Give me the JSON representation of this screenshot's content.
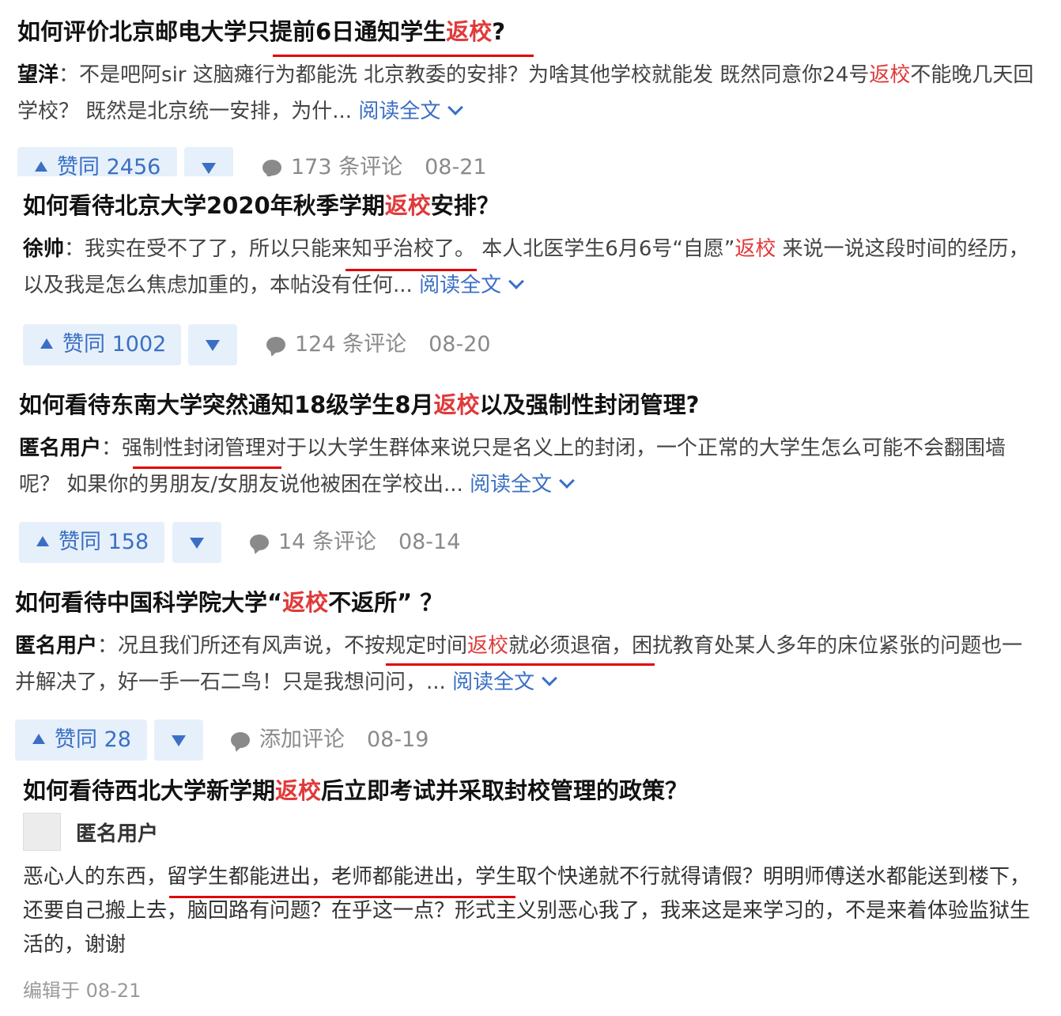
{
  "answers": [
    {
      "title_pre": "如何评价北京邮电大学只提前6日通知学生",
      "title_hl": "返校",
      "title_post": "?",
      "author": "望洋",
      "sep": "：",
      "text_a": "不是吧阿sir 这脑瘫行为都能洗 北京教委的安排？为啥其他学校就能发 既然同意你24号",
      "text_hl": "返校",
      "text_b": "不能晚几天回学校？ 既然是北京统一安排，为什...",
      "read_more": "阅读全文",
      "votes": "赞同 2456",
      "comments": "173 条评论",
      "date": "08-21"
    },
    {
      "title_pre": "如何看待北京大学2020年秋季学期",
      "title_hl": "返校",
      "title_post": "安排？",
      "author": "徐帅",
      "sep": "：",
      "text_a": "我实在受不了了，所以只能来知乎治校了。 本人北医学生6月6号“自愿”",
      "text_hl": "返校",
      "text_b": " 来说一说这段时间的经历，以及我是怎么焦虑加重的，本帖没有任何...",
      "read_more": "阅读全文",
      "votes": "赞同 1002",
      "comments": "124 条评论",
      "date": "08-20"
    },
    {
      "title_pre": "如何看待东南大学突然通知18级学生8月",
      "title_hl": "返校",
      "title_post": "以及强制性封闭管理?",
      "author": "匿名用户",
      "sep": "：",
      "text_a": "强制性封闭管理对于以大学生群体来说只是名义上的封闭，一个正常的大学生怎么可能不会翻围墙呢？ 如果你的男朋友/女朋友说他被困在学校出...",
      "text_hl": "",
      "text_b": "",
      "read_more": "阅读全文",
      "votes": "赞同 158",
      "comments": "14 条评论",
      "date": "08-14"
    },
    {
      "title_pre": "如何看待中国科学院大学“",
      "title_hl": "返校",
      "title_post": "不返所” ？",
      "author": "匿名用户",
      "sep": "：",
      "text_a": "况且我们所还有风声说，不按规定时间",
      "text_hl": "返校",
      "text_b": "就必须退宿，困扰教育处某人多年的床位紧张的问题也一并解决了，好一手一石二鸟！只是我想问问，...",
      "read_more": "阅读全文",
      "votes": "赞同 28",
      "comments": "添加评论",
      "date": "08-19"
    }
  ],
  "last": {
    "title_pre": "如何看待西北大学新学期",
    "title_hl": "返校",
    "title_post": "后立即考试并采取封校管理的政策？",
    "author": "匿名用户",
    "body": "恶心人的东西，留学生都能进出，老师都能进出，学生取个快递就不行就得请假？明明师傅送水都能送到楼下，还要自己搬上去，脑回路有问题？在乎这一点？形式主义别恶心我了，我来这是来学习的，不是来着体验监狱生活的，谢谢",
    "edited": "编辑于 08-21"
  },
  "colors": {
    "highlight": "#e03a3a",
    "link": "#3b6fc4",
    "underline": "#e00000",
    "vote_bg": "#e6f0fb"
  }
}
